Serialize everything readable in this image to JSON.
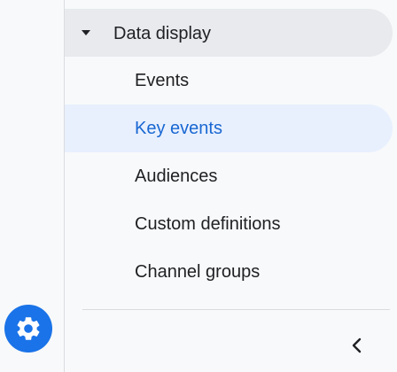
{
  "left_rail": {
    "settings_icon": "gear-icon",
    "settings_color": "#1a73e8"
  },
  "nav": {
    "section": {
      "title": "Data display",
      "icon": "caret-down-icon",
      "expanded": true
    },
    "items": [
      {
        "label": "Events",
        "active": false
      },
      {
        "label": "Key events",
        "active": true
      },
      {
        "label": "Audiences",
        "active": false
      },
      {
        "label": "Custom definitions",
        "active": false
      },
      {
        "label": "Channel groups",
        "active": false
      }
    ],
    "collapse_icon": "chevron-left-icon"
  },
  "colors": {
    "active_bg": "#e8f0fe",
    "active_text": "#1967d2",
    "header_bg": "#e8eaed"
  }
}
